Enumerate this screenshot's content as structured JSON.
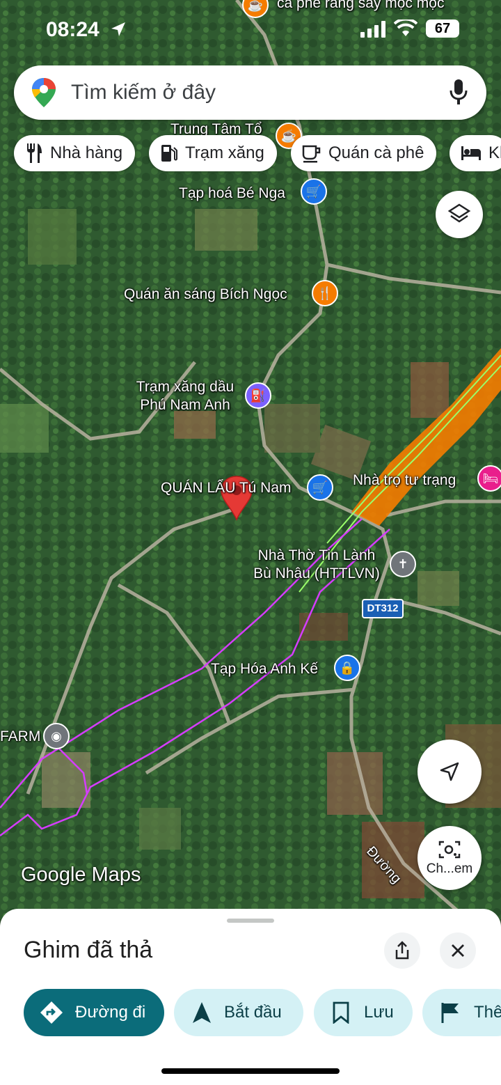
{
  "status_bar": {
    "time": "08:24",
    "battery": "67"
  },
  "search": {
    "placeholder": "Tìm kiếm ở đây"
  },
  "chips": [
    {
      "label": "Nhà hàng",
      "icon": "fork-knife-icon"
    },
    {
      "label": "Trạm xăng",
      "icon": "gas-pump-icon"
    },
    {
      "label": "Quán cà phê",
      "icon": "coffee-cup-icon"
    },
    {
      "label": "Kh",
      "icon": "bed-icon"
    }
  ],
  "map": {
    "top_label": "cà phê rang say mộc mọc",
    "places": [
      {
        "name": "Trung Tâm Tổ",
        "icon": "coffee-icon",
        "color": "#f57c00"
      },
      {
        "name": "Tạp hoá Bé Nga",
        "icon": "shopping-cart-icon",
        "color": "#1a73e8"
      },
      {
        "name": "Quán ăn sáng Bích Ngọc",
        "icon": "fork-knife-icon",
        "color": "#f57c00"
      },
      {
        "name": "Trạm xăng dầu",
        "name2": "Phú Nam Anh",
        "icon": "gas-pump-icon",
        "color": "#7b61ff"
      },
      {
        "name": "QUÁN LẨU Tú Nam",
        "icon": "shopping-cart-icon",
        "color": "#1a73e8"
      },
      {
        "name": "Nhà trọ tư trạng",
        "icon": "bed-icon",
        "color": "#e91e8c"
      },
      {
        "name": "Nhà Thờ Tin Lành",
        "name2": "Bù Nhâu (HTTLVN)",
        "icon": "cross-icon",
        "color": "#70757a"
      },
      {
        "name": "Tạp Hóa Anh Kế",
        "icon": "shopping-bag-icon",
        "color": "#1a73e8"
      },
      {
        "name": "FARM",
        "icon": "pin-circle-icon",
        "color": "#70757a"
      }
    ],
    "road_shield": "DT312",
    "road_name": "Đường",
    "watermark": "Google Maps",
    "lens_label": "Ch...em"
  },
  "sheet": {
    "title": "Ghim đã thả",
    "actions": [
      {
        "label": "Đường đi",
        "icon": "directions-icon"
      },
      {
        "label": "Bắt đầu",
        "icon": "navigation-arrow-icon"
      },
      {
        "label": "Lưu",
        "icon": "bookmark-icon"
      },
      {
        "label": "Thê",
        "icon": "flag-icon"
      }
    ]
  },
  "colors": {
    "accent": "#0b6c7a",
    "chip_bg": "#d4f1f5",
    "pin": "#e53935",
    "route": "#f57c00"
  }
}
